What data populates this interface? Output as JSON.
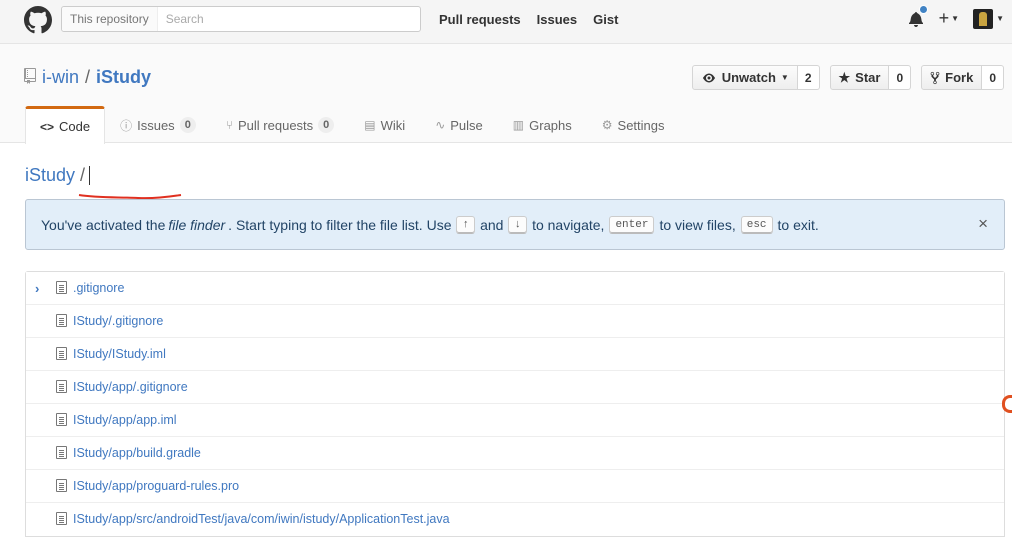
{
  "header": {
    "search_scope": "This repository",
    "search_placeholder": "Search",
    "nav": [
      "Pull requests",
      "Issues",
      "Gist"
    ],
    "icons": [
      "github-logo-icon",
      "bell-icon",
      "plus-icon",
      "avatar"
    ]
  },
  "repo": {
    "owner": "i-win",
    "separator": "/",
    "name": "iStudy",
    "unwatch_label": "Unwatch",
    "watch_count": "2",
    "star_label": "Star",
    "star_count": "0",
    "fork_label": "Fork",
    "fork_count": "0"
  },
  "tabs": [
    {
      "label": "Code",
      "icon": "code-icon",
      "selected": true
    },
    {
      "label": "Issues",
      "icon": "issue-icon",
      "counter": "0"
    },
    {
      "label": "Pull requests",
      "icon": "pull-request-icon",
      "counter": "0"
    },
    {
      "label": "Wiki",
      "icon": "book-icon"
    },
    {
      "label": "Pulse",
      "icon": "pulse-icon"
    },
    {
      "label": "Graphs",
      "icon": "graph-icon"
    },
    {
      "label": "Settings",
      "icon": "gear-icon"
    }
  ],
  "breadcrumb": {
    "root": "iStudy",
    "separator": "/"
  },
  "flash": {
    "text_1": "You've activated the",
    "emphasis": "file finder",
    "text_2": ". Start typing to filter the file list. Use",
    "key_up": "↑",
    "text_and": "and",
    "key_down": "↓",
    "text_navigate": "to navigate,",
    "key_enter": "enter",
    "text_view": "to view files,",
    "key_esc": "esc",
    "text_exit": "to exit.",
    "close": "×"
  },
  "files": [
    ".gitignore",
    "IStudy/.gitignore",
    "IStudy/IStudy.iml",
    "IStudy/app/.gitignore",
    "IStudy/app/app.iml",
    "IStudy/app/build.gradle",
    "IStudy/app/proguard-rules.pro",
    "IStudy/app/src/androidTest/java/com/iwin/istudy/ApplicationTest.java"
  ],
  "colors": {
    "accent": "#4078c0",
    "tab_highlight": "#d26911",
    "flash_bg": "#e2eef9",
    "annotation": "#e03020"
  }
}
